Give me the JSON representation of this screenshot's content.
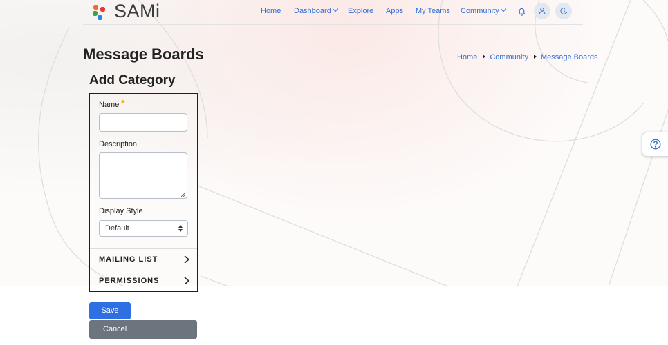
{
  "brand": {
    "name": "SAMi"
  },
  "nav": {
    "home": "Home",
    "dashboard": "Dashboard",
    "explore": "Explore",
    "apps": "Apps",
    "my_teams": "My Teams",
    "community": "Community"
  },
  "page": {
    "title": "Message Boards"
  },
  "breadcrumb": {
    "items": [
      "Home",
      "Community",
      "Message Boards"
    ]
  },
  "form": {
    "section_title": "Add Category",
    "name_label": "Name",
    "required_mark": "★",
    "name_value": "",
    "description_label": "Description",
    "description_value": "",
    "display_style_label": "Display Style",
    "display_style_value": "Default",
    "panels": [
      "MAILING LIST",
      "PERMISSIONS"
    ]
  },
  "actions": {
    "save": "Save",
    "cancel": "Cancel"
  },
  "colors": {
    "accent": "#2f6fe4",
    "link": "#2f6fd6",
    "cancel": "#6c757d",
    "required": "#f2b705"
  },
  "icons": [
    "bell-icon",
    "user-icon",
    "moon-icon",
    "help-icon",
    "chevron-right-icon",
    "chevron-down-icon"
  ]
}
